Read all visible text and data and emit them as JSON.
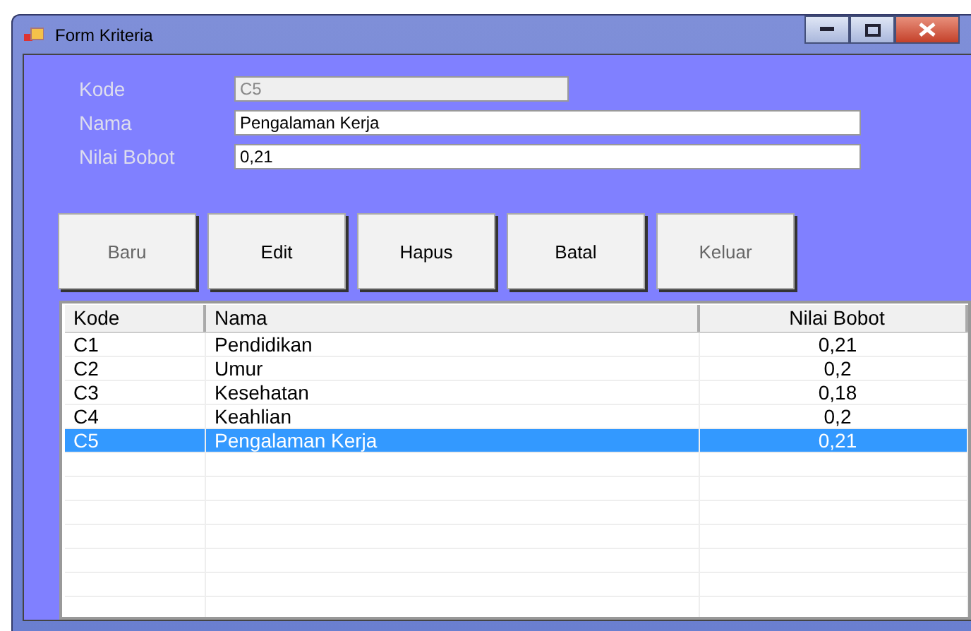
{
  "window": {
    "title": "Form Kriteria"
  },
  "fields": [
    {
      "label": "Kode",
      "value": "C5",
      "disabled": true,
      "wide": false
    },
    {
      "label": "Nama",
      "value": "Pengalaman Kerja",
      "disabled": false,
      "wide": true
    },
    {
      "label": "Nilai Bobot",
      "value": "0,21",
      "disabled": false,
      "wide": true
    }
  ],
  "buttons": [
    {
      "label": "Baru",
      "disabled": true
    },
    {
      "label": "Edit",
      "disabled": false
    },
    {
      "label": "Hapus",
      "disabled": false
    },
    {
      "label": "Batal",
      "disabled": false
    },
    {
      "label": "Keluar",
      "disabled": true
    }
  ],
  "table": {
    "columns": [
      "Kode",
      "Nama",
      "Nilai Bobot"
    ],
    "rows": [
      {
        "cells": [
          "C1",
          "Pendidikan",
          "0,21"
        ],
        "selected": false
      },
      {
        "cells": [
          "C2",
          "Umur",
          "0,2"
        ],
        "selected": false
      },
      {
        "cells": [
          "C3",
          "Kesehatan",
          "0,18"
        ],
        "selected": false
      },
      {
        "cells": [
          "C4",
          "Keahlian",
          "0,2"
        ],
        "selected": false
      },
      {
        "cells": [
          "C5",
          "Pengalaman Kerja",
          "0,21"
        ],
        "selected": true
      }
    ]
  }
}
